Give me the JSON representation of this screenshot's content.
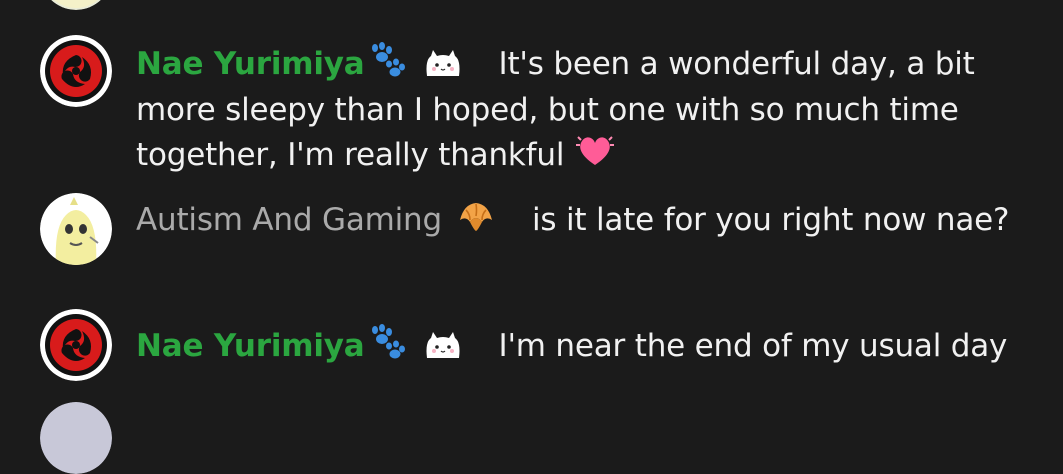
{
  "messages": [
    {
      "author": "Nae Yurimiya",
      "author_color": "#2ba640",
      "badges": [
        "paw-prints-icon",
        "cat-emote-icon"
      ],
      "avatar": "tomoe-red-avatar",
      "text": "It's been a wonderful day, a bit more sleepy than I hoped, but one with so much time together, I'm really thankful",
      "trailing_emoji": "💓"
    },
    {
      "author": "Autism And Gaming",
      "author_color": "#aaaaaa",
      "badges": [
        "croissant-icon"
      ],
      "avatar": "cartoon-character-avatar",
      "text": "is it late for you right now nae?"
    },
    {
      "author": "Nae Yurimiya",
      "author_color": "#2ba640",
      "badges": [
        "paw-prints-icon",
        "cat-emote-icon"
      ],
      "avatar": "tomoe-red-avatar",
      "text": "I'm near the end of my usual day"
    }
  ],
  "colors": {
    "background": "#1b1b1b",
    "message_text": "#f1f1f1",
    "member_name": "#2ba640",
    "viewer_name": "#aaaaaa"
  }
}
